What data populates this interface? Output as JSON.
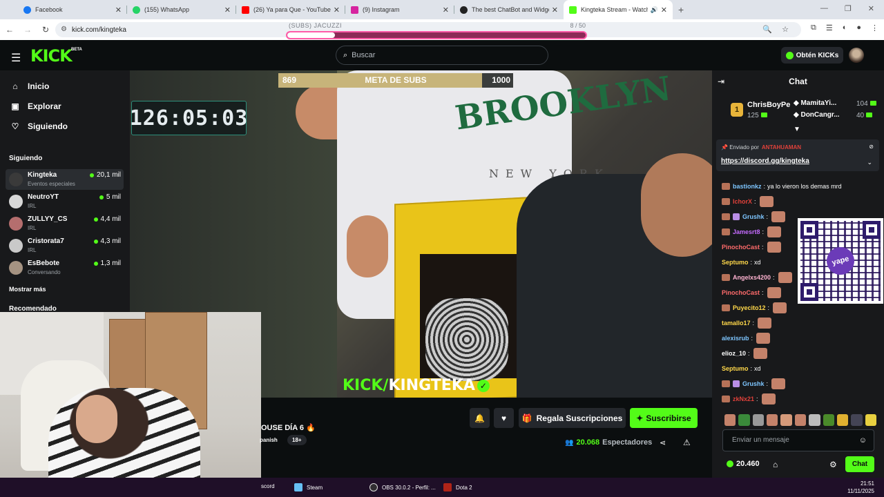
{
  "browser": {
    "tabs": [
      {
        "title": "Facebook",
        "color": "#1877f2"
      },
      {
        "title": "(155) WhatsApp",
        "color": "#25d366"
      },
      {
        "title": "(26) Ya para Que - YouTube",
        "color": "#ff0000"
      },
      {
        "title": "(9) Instagram",
        "color": "#d6249f"
      },
      {
        "title": "The best ChatBot and Widgets",
        "color": "#222222"
      },
      {
        "title": "Kingteka Stream - Watch Li",
        "color": "#53fc18"
      }
    ],
    "url": "kick.com/kingteka"
  },
  "subs_overlay": {
    "label": "(SUBS) JACUZZI",
    "count": "8 / 50",
    "progress": 0.16
  },
  "kick": {
    "logo": "KICK",
    "beta": "BETA",
    "search_placeholder": "Buscar",
    "kicks_button": "Obtén KICKs"
  },
  "sidebar": {
    "nav": [
      {
        "label": "Inicio",
        "icon": "home-icon"
      },
      {
        "label": "Explorar",
        "icon": "compass-icon"
      },
      {
        "label": "Siguiendo",
        "icon": "heart-icon"
      }
    ],
    "following_title": "Siguiendo",
    "channels": [
      {
        "name": "Kingteka",
        "category": "Eventos especiales",
        "viewers": "20,1 mil"
      },
      {
        "name": "NeutroYT",
        "category": "IRL",
        "viewers": "5 mil"
      },
      {
        "name": "ZULLYY_CS",
        "category": "IRL",
        "viewers": "4,4 mil"
      },
      {
        "name": "Cristorata7",
        "category": "IRL",
        "viewers": "4,3 mil"
      },
      {
        "name": "EsBebote",
        "category": "Conversando",
        "viewers": "1,3 mil"
      }
    ],
    "show_more": "Mostrar más",
    "recommended_title": "Recomendado"
  },
  "video": {
    "meta_label": "META DE SUBS",
    "meta_current": "869",
    "meta_max": "1000",
    "meta_progress": 0.869,
    "timer": "126:05:03",
    "watermark_a": "KICK/",
    "watermark_b": "KINGTEKA",
    "hoodie_text": "BROOKLYN",
    "hoodie_sub": "NEW YORK"
  },
  "stream_info": {
    "title_fragment": "OUSE DÍA 6 🔥",
    "tags": [
      "panish",
      "18+"
    ],
    "gift_button": "Regala Suscripciones",
    "subscribe_button": "Suscribirse",
    "viewers": "20.068",
    "viewers_label": "Espectadores"
  },
  "chat": {
    "title": "Chat",
    "leaderboard": [
      {
        "name": "ChrisBoyPe",
        "value": "125",
        "color": "#e8b43a"
      },
      {
        "name": "MamitaYi...",
        "value": "104",
        "color": "#ffffff"
      },
      {
        "name": "DonCangr...",
        "value": "40",
        "color": "#e8b43a"
      }
    ],
    "pinned": {
      "prefix": "Enviado por",
      "sender": "ANTAHUAMAN",
      "link": "https://discord.gg/kingteka"
    },
    "messages": [
      {
        "user": "bastionkz",
        "text": "ya lo vieron los demas mrd",
        "color": "#7ec6ff",
        "badge": "emote"
      },
      {
        "user": "IchorX",
        "text": "",
        "color": "#e0413a",
        "badge": "emote"
      },
      {
        "user": "Grushk",
        "text": "",
        "color": "#7ec6ff",
        "badge": "gift"
      },
      {
        "user": "Jamesrt8",
        "text": "",
        "color": "#c56bff",
        "badge": "emote"
      },
      {
        "user": "PinochoCast",
        "text": "",
        "color": "#ff6b6b",
        "badge": "none"
      },
      {
        "user": "Septumo",
        "text": "xd",
        "color": "#ffd84a",
        "badge": "none"
      },
      {
        "user": "Angelxs4200",
        "text": "",
        "color": "#ffb3d1",
        "badge": "emote"
      },
      {
        "user": "PinochoCast",
        "text": "",
        "color": "#ff6b6b",
        "badge": "none"
      },
      {
        "user": "Puyecito12",
        "text": "",
        "color": "#ffd84a",
        "badge": "emote"
      },
      {
        "user": "tamallo17",
        "text": "",
        "color": "#ffd84a",
        "badge": "none"
      },
      {
        "user": "alexisrub",
        "text": "",
        "color": "#7ec6ff",
        "badge": "none"
      },
      {
        "user": "elioz_10",
        "text": "",
        "color": "#ffffff",
        "badge": "none"
      },
      {
        "user": "Septumo",
        "text": "xd",
        "color": "#ffd84a",
        "badge": "none"
      },
      {
        "user": "Grushk",
        "text": "",
        "color": "#7ec6ff",
        "badge": "gift"
      },
      {
        "user": "zkNx21",
        "text": "",
        "color": "#e0413a",
        "badge": "emote"
      }
    ],
    "qr_logo": "yape",
    "input_placeholder": "Enviar un mensaje",
    "kicks_balance": "20.460",
    "send_button": "Chat"
  },
  "taskbar": {
    "items": [
      {
        "label": "scord",
        "color": "#5865f2"
      },
      {
        "label": "Steam",
        "color": "#1b2838"
      },
      {
        "label": "OBS 30.0.2 - Perfil: ...",
        "color": "#302e31"
      },
      {
        "label": "Dota 2",
        "color": "#b02418"
      }
    ],
    "time": "21:51",
    "date": "11/11/2025"
  }
}
